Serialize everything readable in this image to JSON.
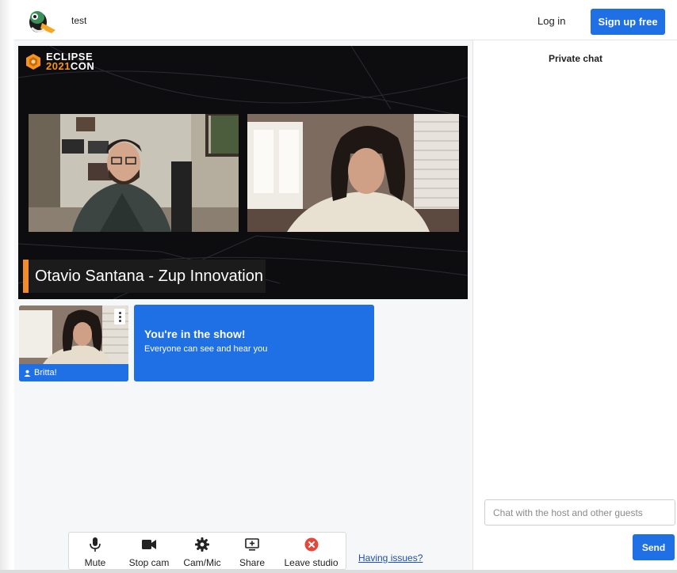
{
  "header": {
    "app_title": "test",
    "login_label": "Log in",
    "signup_label": "Sign up free"
  },
  "stage": {
    "brand_line1": "ECLIPSE",
    "brand_year": "2021",
    "brand_con": "CON",
    "lower_third": "Otavio Santana - Zup Innovation"
  },
  "self_tile": {
    "name": "Britta!"
  },
  "banner": {
    "title": "You're in the show!",
    "subtitle": "Everyone can see and hear you"
  },
  "controls": [
    {
      "label": "Mute",
      "icon": "microphone-icon"
    },
    {
      "label": "Stop cam",
      "icon": "camera-icon"
    },
    {
      "label": "Cam/Mic",
      "icon": "gear-icon"
    },
    {
      "label": "Share",
      "icon": "share-screen-icon"
    },
    {
      "label": "Leave studio",
      "icon": "leave-icon"
    }
  ],
  "having_issues": "Having issues?",
  "chat": {
    "title": "Private chat",
    "placeholder": "Chat with the host and other guests",
    "send_label": "Send"
  },
  "colors": {
    "accent": "#1f6fe5",
    "leave": "#e5483b",
    "lower_third_bar": "#f28c28"
  }
}
